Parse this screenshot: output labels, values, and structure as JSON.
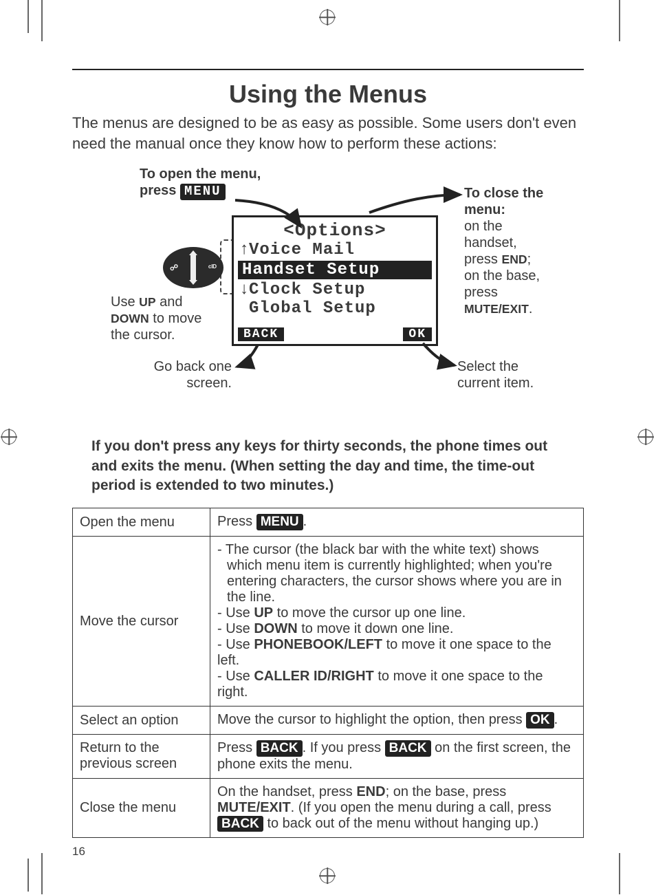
{
  "page": {
    "title": "Using the Menus",
    "intro": "The menus are designed to be as easy as possible. Some users don't even need the manual once they know how to perform these actions:",
    "timeout_note": "If you don't press any keys for thirty seconds, the phone times out and exits the menu. (When setting the day and time, the time-out period is extended to two minutes.)",
    "number": "16"
  },
  "diagram": {
    "open": {
      "line1": "To open the menu,",
      "line2_prefix": "press",
      "button": "MENU"
    },
    "close": {
      "line1": "To close the",
      "line2": "menu:",
      "body1": "on the",
      "body2": "handset,",
      "body3_prefix": "press ",
      "body3_key": "END",
      "body3_suffix": ";",
      "body4": "on the base,",
      "body5": "press",
      "body6_key": "MUTE/EXIT",
      "body6_suffix": "."
    },
    "use_updown": {
      "prefix": "Use ",
      "up": "UP",
      "mid": " and ",
      "down": "DOWN",
      "suffix1": " to move",
      "suffix2": "the cursor."
    },
    "go_back": {
      "line1": "Go back one",
      "line2": "screen."
    },
    "select": {
      "line1": "Select the",
      "line2": "current item."
    },
    "lcd": {
      "title": "<Options>",
      "row1": "Voice Mail",
      "row2_hl": "Handset Setup",
      "row3": "Clock Setup",
      "row4": "Global Setup",
      "sk_left": "BACK",
      "sk_right": "OK"
    }
  },
  "table": {
    "r1": {
      "left": "Open the menu",
      "right_prefix": "Press ",
      "right_btn": "MENU",
      "right_suffix": "."
    },
    "r2": {
      "left": "Move the cursor",
      "b1": "- The cursor (the black bar with the white text) shows which menu item is currently highlighted; when you're entering characters, the cursor shows where you are in the line.",
      "b2_prefix": "- Use ",
      "b2_key": "UP",
      "b2_suffix": " to move the cursor up one line.",
      "b3_prefix": "- Use ",
      "b3_key": "DOWN",
      "b3_suffix": " to move it down one line.",
      "b4_prefix": "- Use ",
      "b4_key": "PHONEBOOK/LEFT",
      "b4_suffix": " to move it one space to the left.",
      "b5_prefix": "- Use ",
      "b5_key": "CALLER ID/RIGHT",
      "b5_suffix": " to move it one space to the right."
    },
    "r3": {
      "left": "Select an option",
      "right_prefix": "Move the cursor to highlight the option, then press ",
      "right_btn": "OK",
      "right_suffix": "."
    },
    "r4": {
      "left_line1": "Return to the",
      "left_line2": "previous screen",
      "right_p1": "Press ",
      "right_btn1": "BACK",
      "right_p2": ". If you press ",
      "right_btn2": "BACK",
      "right_p3": " on the first screen, the phone exits the menu."
    },
    "r5": {
      "left": "Close the menu",
      "p1": "On the handset, press ",
      "k1": "END",
      "p2": "; on the base, press ",
      "k2": "MUTE/EXIT",
      "p3": ". (If you open the menu during a call, press ",
      "btn": "BACK",
      "p4": " to back out of the menu without hanging up.)"
    }
  }
}
